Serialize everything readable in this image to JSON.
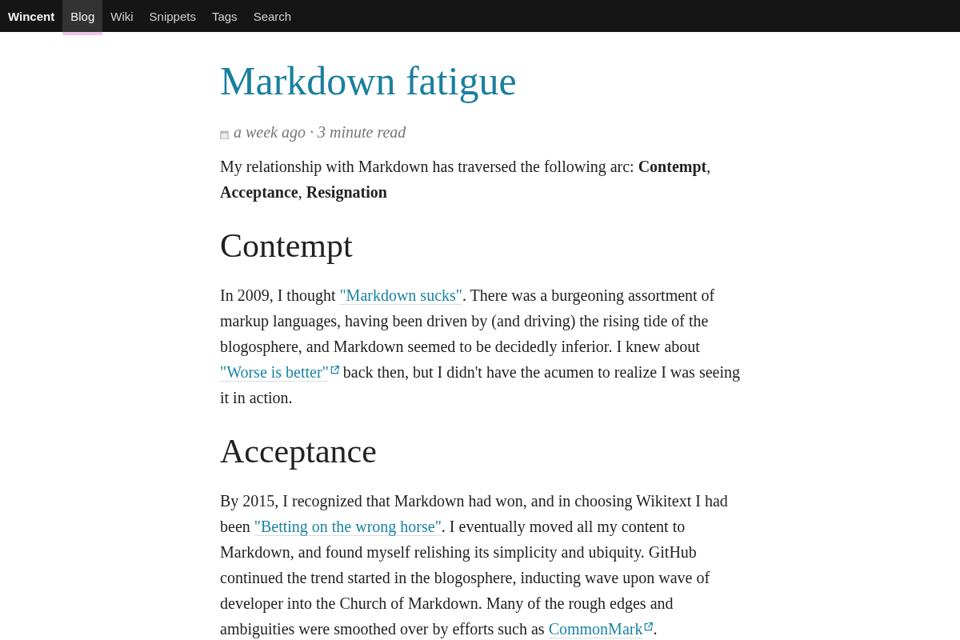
{
  "nav": {
    "brand": "Wincent",
    "items": [
      {
        "label": "Blog",
        "selected": true
      },
      {
        "label": "Wiki",
        "selected": false
      },
      {
        "label": "Snippets",
        "selected": false
      },
      {
        "label": "Tags",
        "selected": false
      },
      {
        "label": "Search",
        "selected": false
      }
    ]
  },
  "article": {
    "title": "Markdown fatigue",
    "meta": "a week ago · 3 minute read",
    "blocks": [
      {
        "kind": "paragraph",
        "parts": [
          {
            "kind": "text",
            "text": "My relationship with Markdown has traversed the following arc: **Contempt**, **Acceptance**, **Resignation**"
          }
        ]
      },
      {
        "kind": "heading",
        "text": "Contempt"
      },
      {
        "kind": "paragraph",
        "parts": [
          {
            "kind": "text",
            "text": "In 2009, I thought "
          },
          {
            "kind": "link",
            "text": "\"Markdown sucks\"",
            "external": false
          },
          {
            "kind": "text",
            "text": ". There was a burgeoning assortment of markup languages, having been driven by (and driving) the rising tide of the blogosphere, and Markdown seemed to be decidedly inferior. I knew about "
          },
          {
            "kind": "link",
            "text": "\"Worse is better\"",
            "external": true
          },
          {
            "kind": "text",
            "text": " back then, but I didn't have the acumen to realize I was seeing it in action."
          }
        ]
      },
      {
        "kind": "heading",
        "text": "Acceptance"
      },
      {
        "kind": "paragraph",
        "parts": [
          {
            "kind": "text",
            "text": "By 2015, I recognized that Markdown had won, and in choosing Wikitext I had been "
          },
          {
            "kind": "link",
            "text": "\"Betting on the wrong horse\"",
            "external": false
          },
          {
            "kind": "text",
            "text": ". I eventually moved all my content to Markdown, and found myself relishing its simplicity and ubiquity. GitHub continued the trend started in the blogosphere, inducting wave upon wave of developer into the Church of Markdown. Many of the rough edges and ambiguities were smoothed over by efforts such as "
          },
          {
            "kind": "link",
            "text": "CommonMark",
            "external": true
          },
          {
            "kind": "text",
            "text": "."
          }
        ]
      }
    ]
  }
}
